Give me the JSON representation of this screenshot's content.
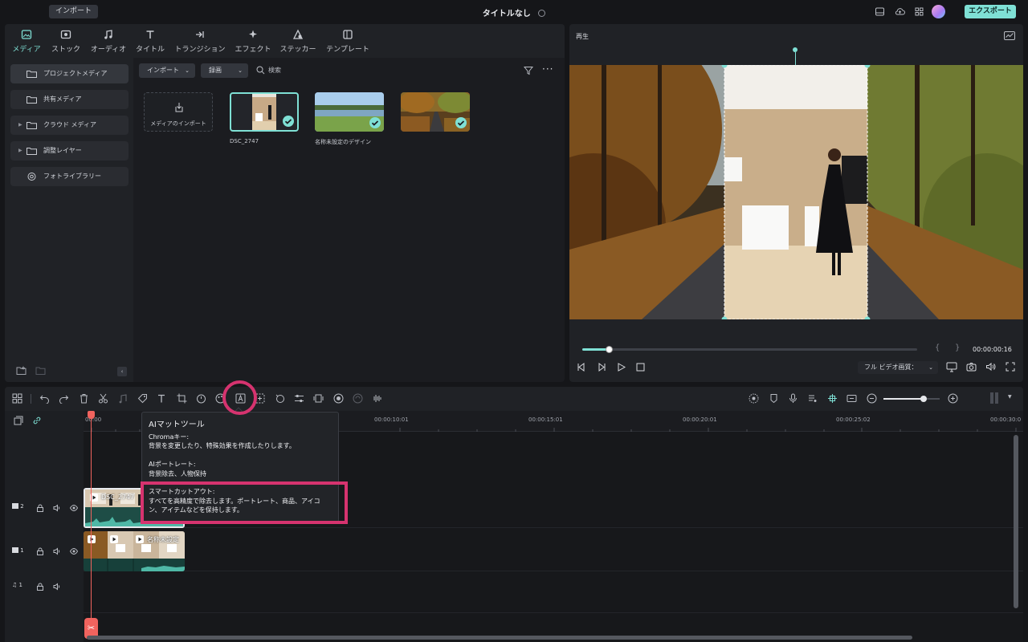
{
  "app": {
    "import_label": "インポート",
    "title": "タイトルなし",
    "export_label": "エクスポート"
  },
  "media_tabs": [
    {
      "label": "メディア",
      "icon": "media-icon",
      "active": true
    },
    {
      "label": "ストック",
      "icon": "stock-icon"
    },
    {
      "label": "オーディオ",
      "icon": "music-note-icon"
    },
    {
      "label": "タイトル",
      "icon": "text-t-icon"
    },
    {
      "label": "トランジション",
      "icon": "transition-icon"
    },
    {
      "label": "エフェクト",
      "icon": "effect-sparkle-icon"
    },
    {
      "label": "ステッカー",
      "icon": "sticker-icon"
    },
    {
      "label": "テンプレート",
      "icon": "template-icon"
    }
  ],
  "sidebar": {
    "items": [
      {
        "label": "プロジェクトメディア",
        "active": true
      },
      {
        "label": "共有メディア"
      },
      {
        "label": "クラウド メディア",
        "expandable": true
      },
      {
        "label": "調整レイヤー",
        "expandable": true
      },
      {
        "label": "フォトライブラリー",
        "icon": "photos-icon"
      }
    ]
  },
  "media_toolbar": {
    "import_dropdown": "インポート",
    "record_dropdown": "録画",
    "search_placeholder": "検索"
  },
  "media_items": [
    {
      "label": "メディアのインポート",
      "type": "import"
    },
    {
      "label": "DSC_2747",
      "selected": true,
      "checked": true
    },
    {
      "label": "名称未設定のデザイン",
      "checked": true
    },
    {
      "label": "",
      "checked": true
    }
  ],
  "player": {
    "label": "再生",
    "timecode": "00:00:00:16",
    "progress": 0.08,
    "quality": "フル ビデオ画質：",
    "brace_open": "{",
    "brace_close": "}"
  },
  "timeline": {
    "ruler": [
      "00:00",
      "00:00:10:01",
      "00:00:15:01",
      "00:00:20:01",
      "00:00:25:02",
      "00:00:30:0"
    ],
    "zoom": 0.72,
    "tracks": [
      {
        "id": "video-2",
        "label": "2",
        "clip_title": "DSC_2747"
      },
      {
        "id": "video-1",
        "label": "1",
        "clip_title": "名称未設定"
      },
      {
        "id": "audio-1",
        "label": "1"
      }
    ]
  },
  "tooltip": {
    "title": "AIマットツール",
    "sections": [
      {
        "heading": "Chromaキー:",
        "body": "背景を変更したり、特殊効果を作成したりします。"
      },
      {
        "heading": "AIポートレート:",
        "body": "背景除去、人物保持"
      },
      {
        "heading": "スマートカットアウト:",
        "body_line1": "すべてを高精度で除去します。ポートレート、商品、アイコ",
        "body_line2": "ン、アイテムなどを保持します。"
      }
    ]
  },
  "colors": {
    "accent": "#7fe0d5",
    "highlight": "#d6336f",
    "playhead": "#f0635e"
  }
}
